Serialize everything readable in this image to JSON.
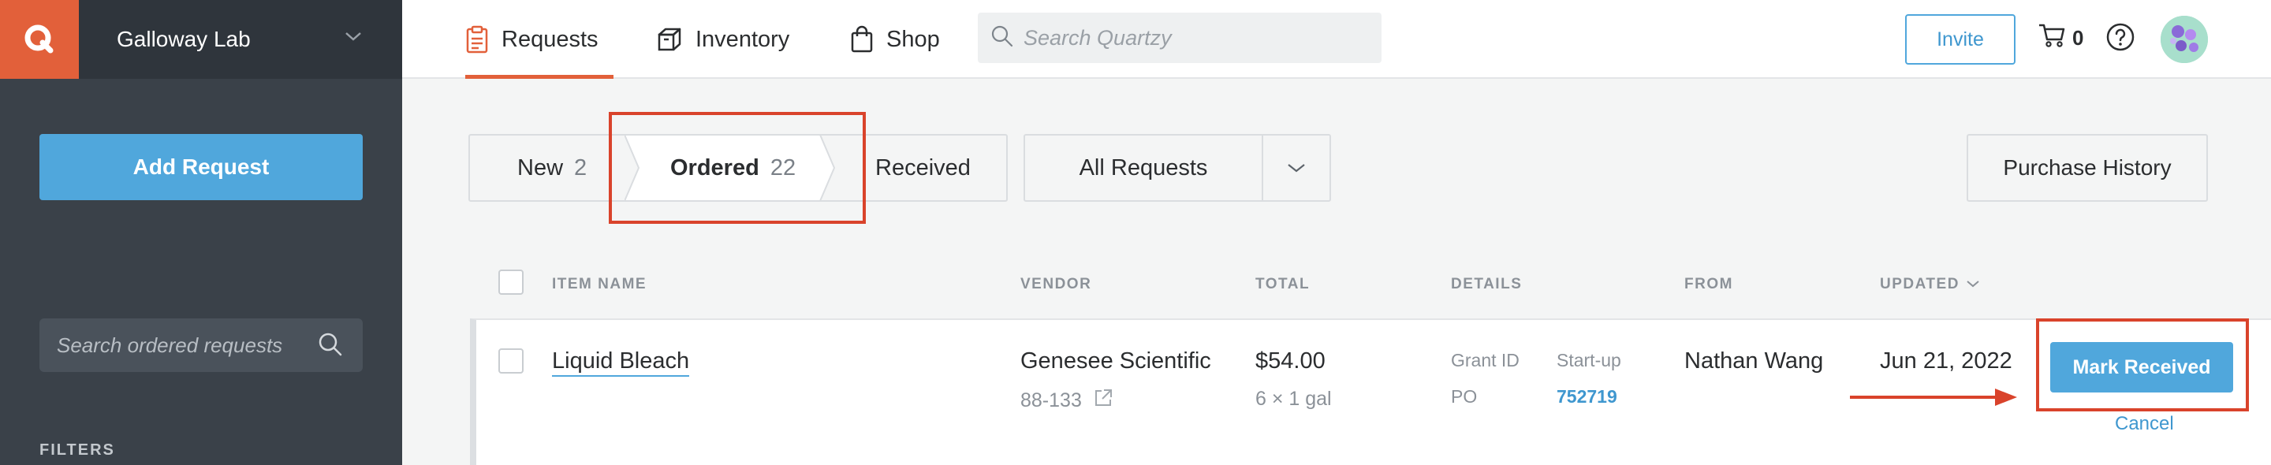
{
  "sidebar": {
    "lab_name": "Galloway Lab",
    "add_request_label": "Add Request",
    "search_placeholder": "Search ordered requests",
    "filters_label": "FILTERS"
  },
  "topbar": {
    "nav": [
      {
        "label": "Requests",
        "icon": "clipboard-icon",
        "active": true
      },
      {
        "label": "Inventory",
        "icon": "box-icon",
        "active": false
      },
      {
        "label": "Shop",
        "icon": "shopping-bag-icon",
        "active": false
      }
    ],
    "search_placeholder": "Search Quartzy",
    "invite_label": "Invite",
    "cart_count": "0"
  },
  "status_tabs": [
    {
      "label": "New",
      "count": "2"
    },
    {
      "label": "Ordered",
      "count": "22"
    },
    {
      "label": "Received",
      "count": ""
    }
  ],
  "filter_dropdown": {
    "selected": "All Requests"
  },
  "purchase_history_label": "Purchase History",
  "table": {
    "headers": {
      "item_name": "ITEM NAME",
      "vendor": "VENDOR",
      "total": "TOTAL",
      "details": "DETAILS",
      "from": "FROM",
      "updated": "UPDATED"
    },
    "rows": [
      {
        "item_name": "Liquid Bleach",
        "vendor": "Genesee Scientific",
        "catalog_no": "88-133",
        "total": "$54.00",
        "quantity": "6 × 1 gal",
        "grant_label": "Grant ID",
        "grant_value": "Start-up",
        "po_label": "PO",
        "po_value": "752719",
        "from": "Nathan Wang",
        "updated": "Jun 21, 2022",
        "mark_received_label": "Mark Received",
        "cancel_label": "Cancel"
      }
    ]
  },
  "colors": {
    "accent_orange": "#e2603a",
    "primary_blue": "#50a7dc",
    "highlight_red": "#d9432b",
    "sidebar_bg": "#3a4149"
  }
}
